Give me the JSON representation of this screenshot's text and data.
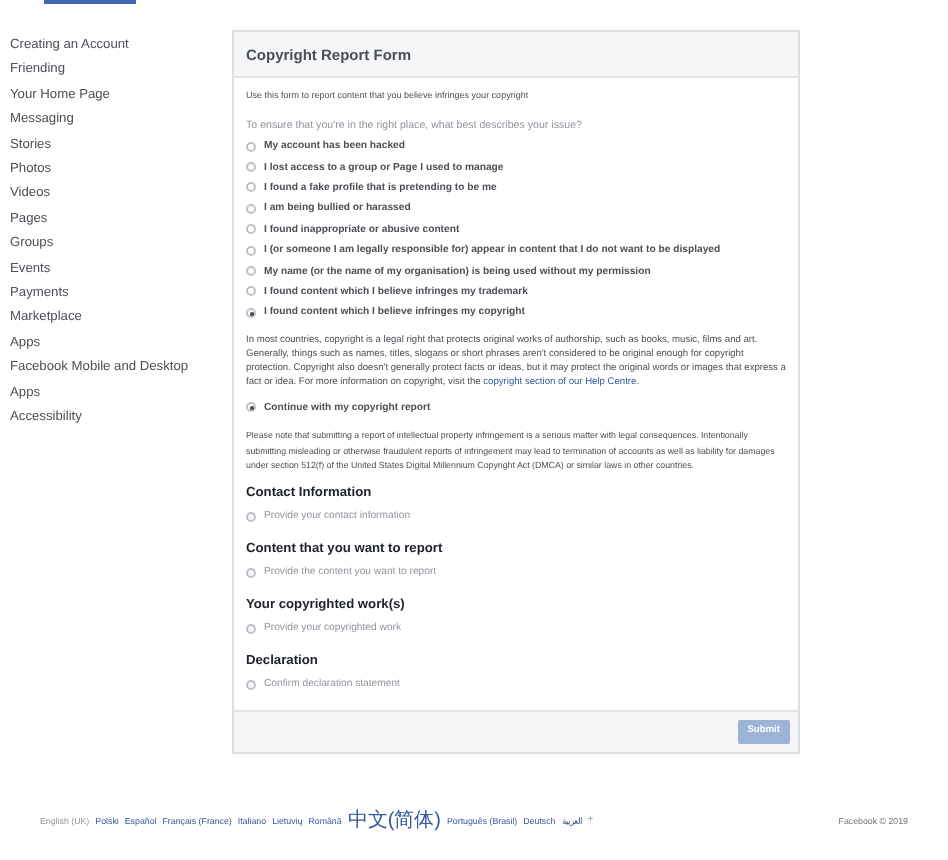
{
  "sidebar": {
    "items": [
      "Creating an Account",
      "Friending",
      "Your Home Page",
      "Messaging",
      "Stories",
      "Photos",
      "Videos",
      "Pages",
      "Groups",
      "Events",
      "Payments",
      "Marketplace",
      "Apps",
      "Facebook Mobile and Desktop Apps",
      "Accessibility"
    ]
  },
  "form": {
    "title": "Copyright Report Form",
    "intro": "Use this form to report content that you believe infringes your copyright",
    "question": "To ensure that you're in the right place, what best describes your issue?",
    "options": [
      {
        "label": "My account has been hacked",
        "selected": false
      },
      {
        "label": "I lost access to a group or Page I used to manage",
        "selected": false
      },
      {
        "label": "I found a fake profile that is pretending to be me",
        "selected": false
      },
      {
        "label": "I am being bullied or harassed",
        "selected": false
      },
      {
        "label": "I found inappropriate or abusive content",
        "selected": false
      },
      {
        "label": "I (or someone I am legally responsible for) appear in content that I do not want to be displayed",
        "selected": false
      },
      {
        "label": "My name (or the name of my organisation) is being used without my permission",
        "selected": false
      },
      {
        "label": "I found content which I believe infringes my trademark",
        "selected": false
      },
      {
        "label": "I found content which I believe infringes my copyright",
        "selected": true
      }
    ],
    "info": {
      "text": "In most countries, copyright is a legal right that protects original works of authorship, such as books, music, films and art. Generally, things such as names, titles, slogans or short phrases aren't considered to be original enough for copyright protection. Copyright also doesn't generally protect facts or ideas, but it may protect the original words or images that express a fact or idea. For more information on copyright, visit the",
      "link": "copyright section of our Help Centre",
      "end": "."
    },
    "continue": {
      "label": "Continue with my copyright report",
      "selected": true
    },
    "note": "Please note that submitting a report of intellectual property infringement is a serious matter with legal consequences. Intentionally submitting misleading or otherwise fraudulent reports of infringement may lead to termination of accounts as well as liability for damages under section 512(f) of the United States Digital Millennium Copyright Act (DMCA) or similar laws in other countries.",
    "sections": [
      {
        "heading": "Contact Information",
        "option": "Provide your contact information",
        "selected": false,
        "disabled": true
      },
      {
        "heading": "Content that you want to report",
        "option": "Provide the content you want to report",
        "selected": false,
        "disabled": true
      },
      {
        "heading": "Your copyrighted work(s)",
        "option": "Provide your copyrighted work",
        "selected": false,
        "disabled": true
      },
      {
        "heading": "Declaration",
        "option": "Confirm declaration statement",
        "selected": false,
        "disabled": true
      }
    ],
    "submit": {
      "label": "Submit",
      "disabled": true
    }
  },
  "footer": {
    "languages": [
      {
        "label": "English (UK)",
        "selected": true
      },
      {
        "label": "Polski",
        "selected": false
      },
      {
        "label": "Español",
        "selected": false
      },
      {
        "label": "Français (France)",
        "selected": false
      },
      {
        "label": "Italiano",
        "selected": false
      },
      {
        "label": "Lietuvių",
        "selected": false
      },
      {
        "label": "Română",
        "selected": false
      },
      {
        "label": "中文(简体)",
        "selected": false
      },
      {
        "label": "Português (Brasil)",
        "selected": false
      },
      {
        "label": "Deutsch",
        "selected": false
      },
      {
        "label": "العربية",
        "selected": false
      }
    ],
    "more": "+",
    "copyright": "Facebook © 2019"
  }
}
